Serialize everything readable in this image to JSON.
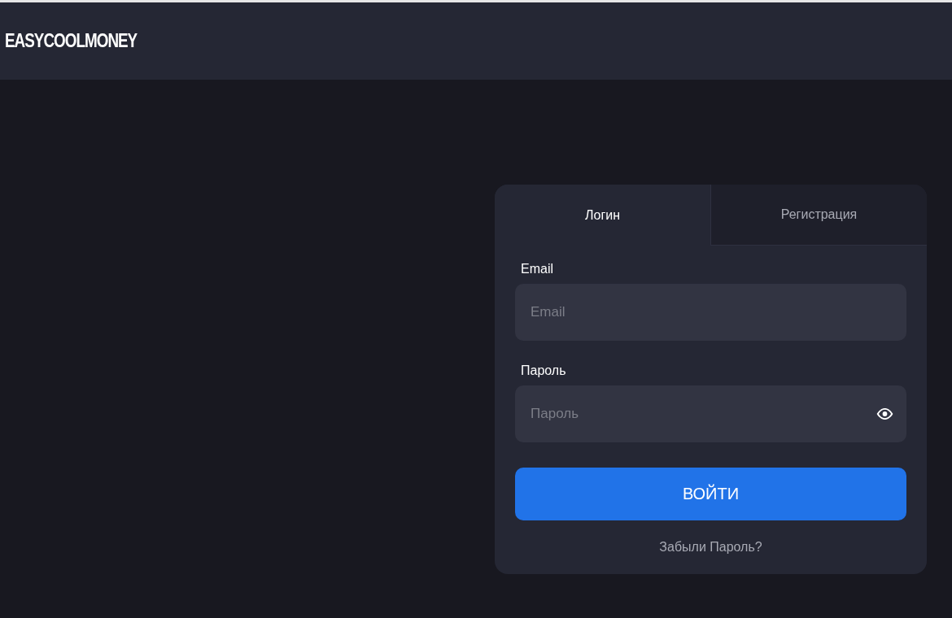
{
  "header": {
    "logo": "EASYCOOLMONEY"
  },
  "tabs": [
    {
      "label": "Логин",
      "selected": true
    },
    {
      "label": "Регистрация",
      "selected": false
    }
  ],
  "fields": [
    {
      "kind": "text",
      "label": "Email",
      "placeholder": "Email"
    },
    {
      "kind": "password",
      "label": "Пароль",
      "placeholder": "Пароль"
    }
  ],
  "submit": "ВОЙТИ",
  "forgot": "Забыли Пароль?"
}
